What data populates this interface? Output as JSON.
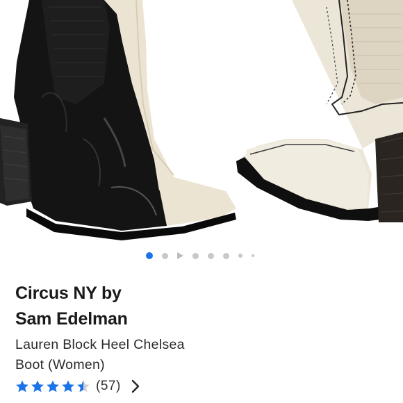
{
  "gallery": {
    "image_alt": "Black patent and cream leather square-toe block heel Chelsea boots",
    "current_index": 1,
    "indicators": [
      "dot",
      "dot",
      "play",
      "dot",
      "dot",
      "dot",
      "small",
      "tiny"
    ]
  },
  "product": {
    "brand_line1": "Circus NY by",
    "brand_line2": "Sam Edelman",
    "name_line1": "Lauren Block Heel Chelsea",
    "name_line2": "Boot (Women)"
  },
  "reviews": {
    "rating": 4.5,
    "max_rating": 5,
    "count_label": "(57)",
    "star_color": "#1a73e8"
  },
  "colors": {
    "accent": "#1a73e8",
    "inactive_dot": "#c8c8c8"
  }
}
